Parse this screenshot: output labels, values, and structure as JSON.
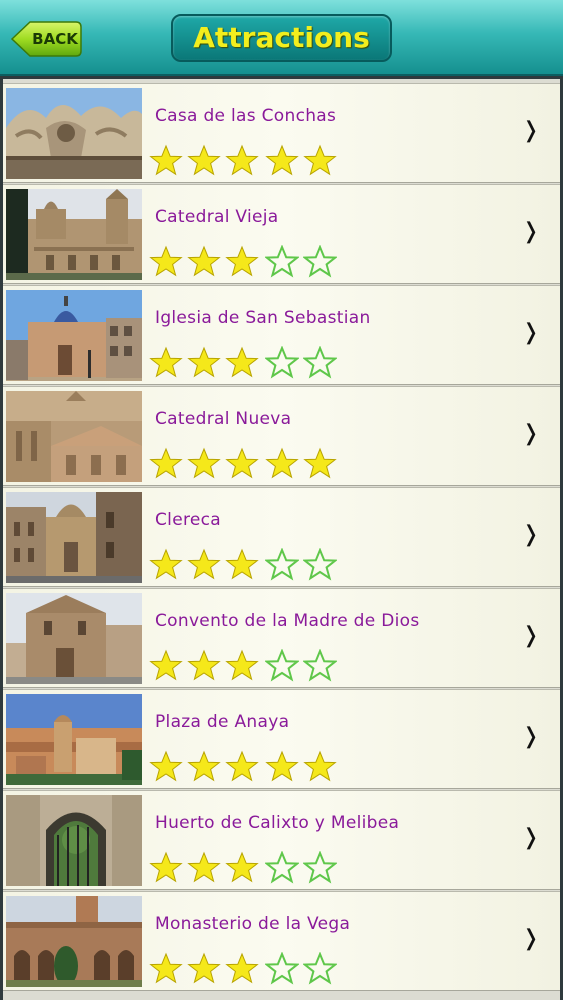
{
  "header": {
    "back_label": "BACK",
    "title": "Attractions"
  },
  "colors": {
    "header_teal": "#1fa9a8",
    "title_yellow": "#f2ee1e",
    "item_purple": "#8a1a9a",
    "star_gold": "#f5e81a",
    "star_outline_green": "#5fc74a"
  },
  "items": [
    {
      "name": "Casa de las Conchas",
      "rating": 5,
      "image": "stone-gargoyle"
    },
    {
      "name": "Catedral Vieja",
      "rating": 3,
      "image": "old-cathedral"
    },
    {
      "name": "Iglesia de San Sebastian",
      "rating": 3,
      "image": "church-dome"
    },
    {
      "name": "Catedral Nueva",
      "rating": 5,
      "image": "new-cathedral"
    },
    {
      "name": "Clereca",
      "rating": 3,
      "image": "clerecia-towers"
    },
    {
      "name": "Convento de la Madre de Dios",
      "rating": 3,
      "image": "convent-facade"
    },
    {
      "name": "Plaza de Anaya",
      "rating": 5,
      "image": "city-panorama"
    },
    {
      "name": "Huerto de Calixto y Melibea",
      "rating": 3,
      "image": "garden-gate"
    },
    {
      "name": "Monasterio de la Vega",
      "rating": 3,
      "image": "monastery-cloister"
    }
  ],
  "chevron_icon": "chevron-right-icon",
  "star_icons": [
    "star-filled-icon",
    "star-outline-icon"
  ]
}
